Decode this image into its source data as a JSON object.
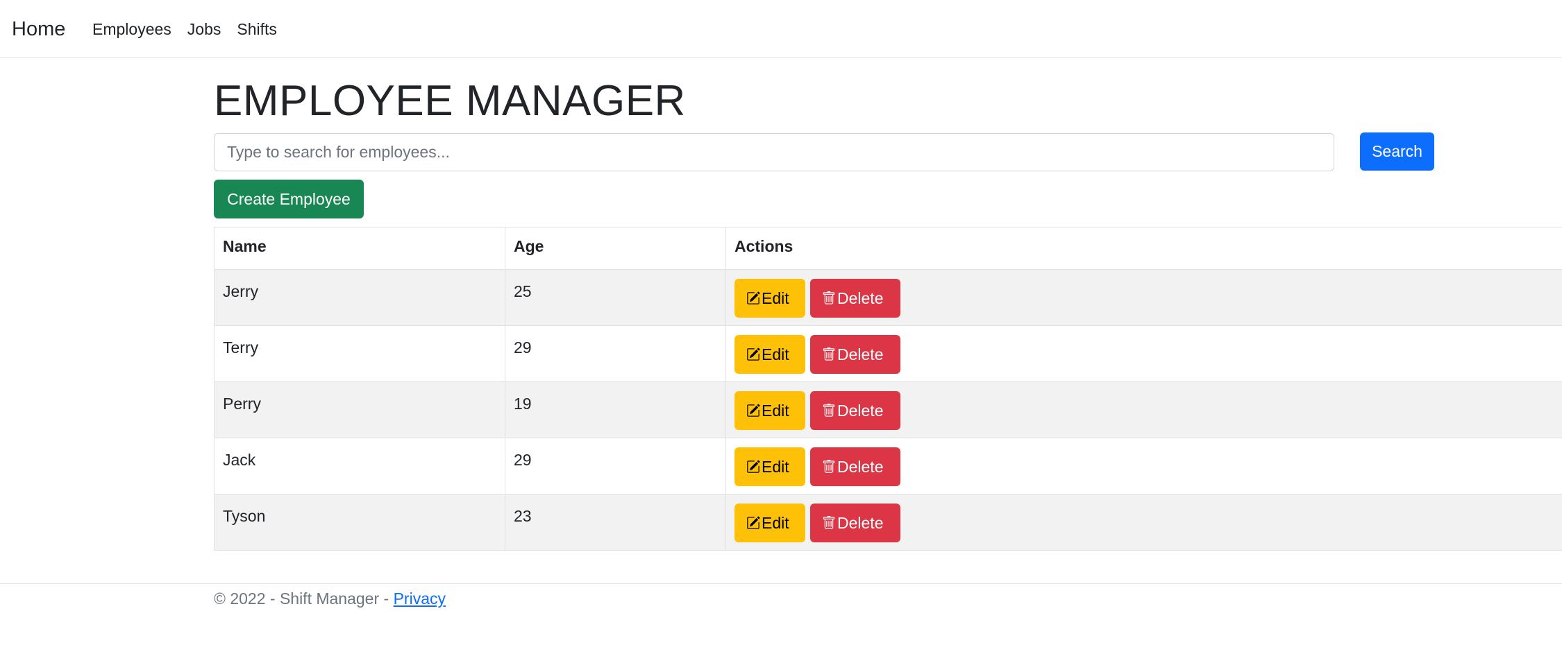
{
  "nav": {
    "brand": "Home",
    "links": [
      "Employees",
      "Jobs",
      "Shifts"
    ]
  },
  "main": {
    "title": "EMPLOYEE MANAGER",
    "search_placeholder": "Type to search for employees...",
    "search_value": "",
    "search_button": "Search",
    "create_button": "Create Employee"
  },
  "table": {
    "headers": [
      "Name",
      "Age",
      "Actions"
    ],
    "rows": [
      {
        "name": "Jerry",
        "age": "25"
      },
      {
        "name": "Terry",
        "age": "29"
      },
      {
        "name": "Perry",
        "age": "19"
      },
      {
        "name": "Jack",
        "age": "29"
      },
      {
        "name": "Tyson",
        "age": "23"
      }
    ],
    "edit_label": "Edit",
    "delete_label": "Delete",
    "edit_icon": "pencil-square-icon",
    "delete_icon": "trash-icon"
  },
  "footer": {
    "text": "© 2022 - Shift Manager - ",
    "privacy_link": "Privacy"
  },
  "colors": {
    "primary": "#0d6efd",
    "success": "#198754",
    "warning": "#ffc107",
    "danger": "#dc3545",
    "stripe": "#f2f2f2"
  }
}
